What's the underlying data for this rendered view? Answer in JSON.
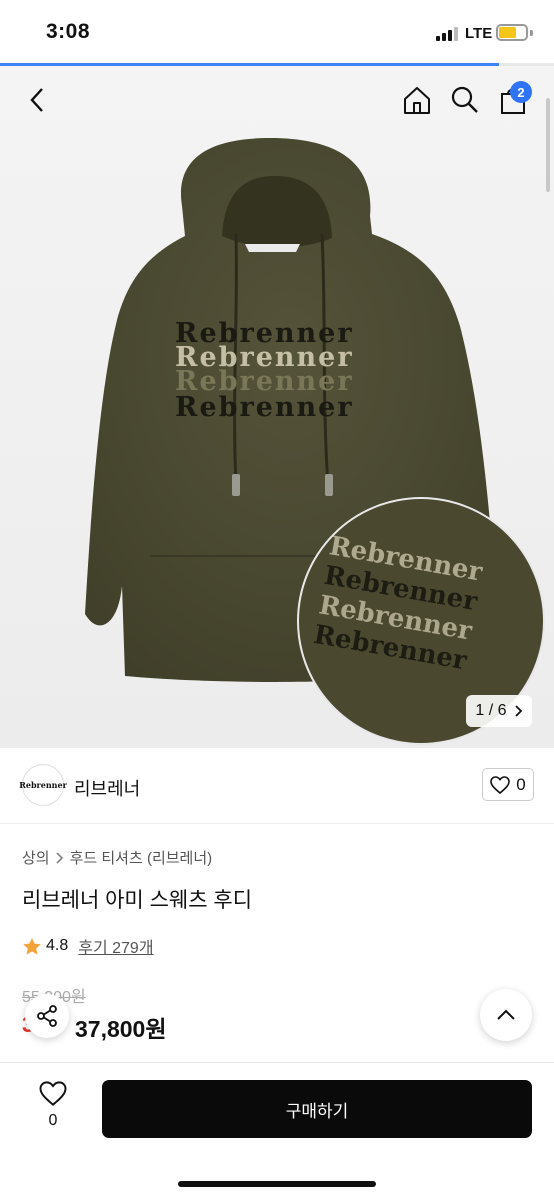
{
  "status_bar": {
    "time": "3:08",
    "network": "LTE",
    "battery_level": 0.6
  },
  "page_load_progress": 0.9,
  "nav": {
    "back_icon": "chevron-left-icon",
    "home_icon": "home-icon",
    "search_icon": "search-icon",
    "cart_icon": "shopping-bag-icon",
    "cart_count": "2"
  },
  "gallery": {
    "current": "1 / 6",
    "next_icon": "chevron-right-icon",
    "print_text": "Rebrenner"
  },
  "brand": {
    "logo_text": "Rebrenner",
    "name": "리브레너",
    "like_count": "0"
  },
  "product": {
    "breadcrumb": [
      "상의",
      "후드 티셔츠 (리브레너)"
    ],
    "title": "리브레너 아미 스웨츠 후디",
    "rating": "4.8",
    "reviews": "후기 279개",
    "original_price": "55,300원",
    "discount": "3",
    "sale_price": "37,800원"
  },
  "actions": {
    "share_icon": "share-icon",
    "scroll_top_icon": "chevron-up-icon"
  },
  "bottom_bar": {
    "wish_count": "0",
    "buy_label": "구매하기"
  },
  "colors": {
    "accent": "#2f74f6",
    "hoodie": "#4b4a30",
    "discount": "#e5352b",
    "buy_button": "#0a0a0a"
  }
}
